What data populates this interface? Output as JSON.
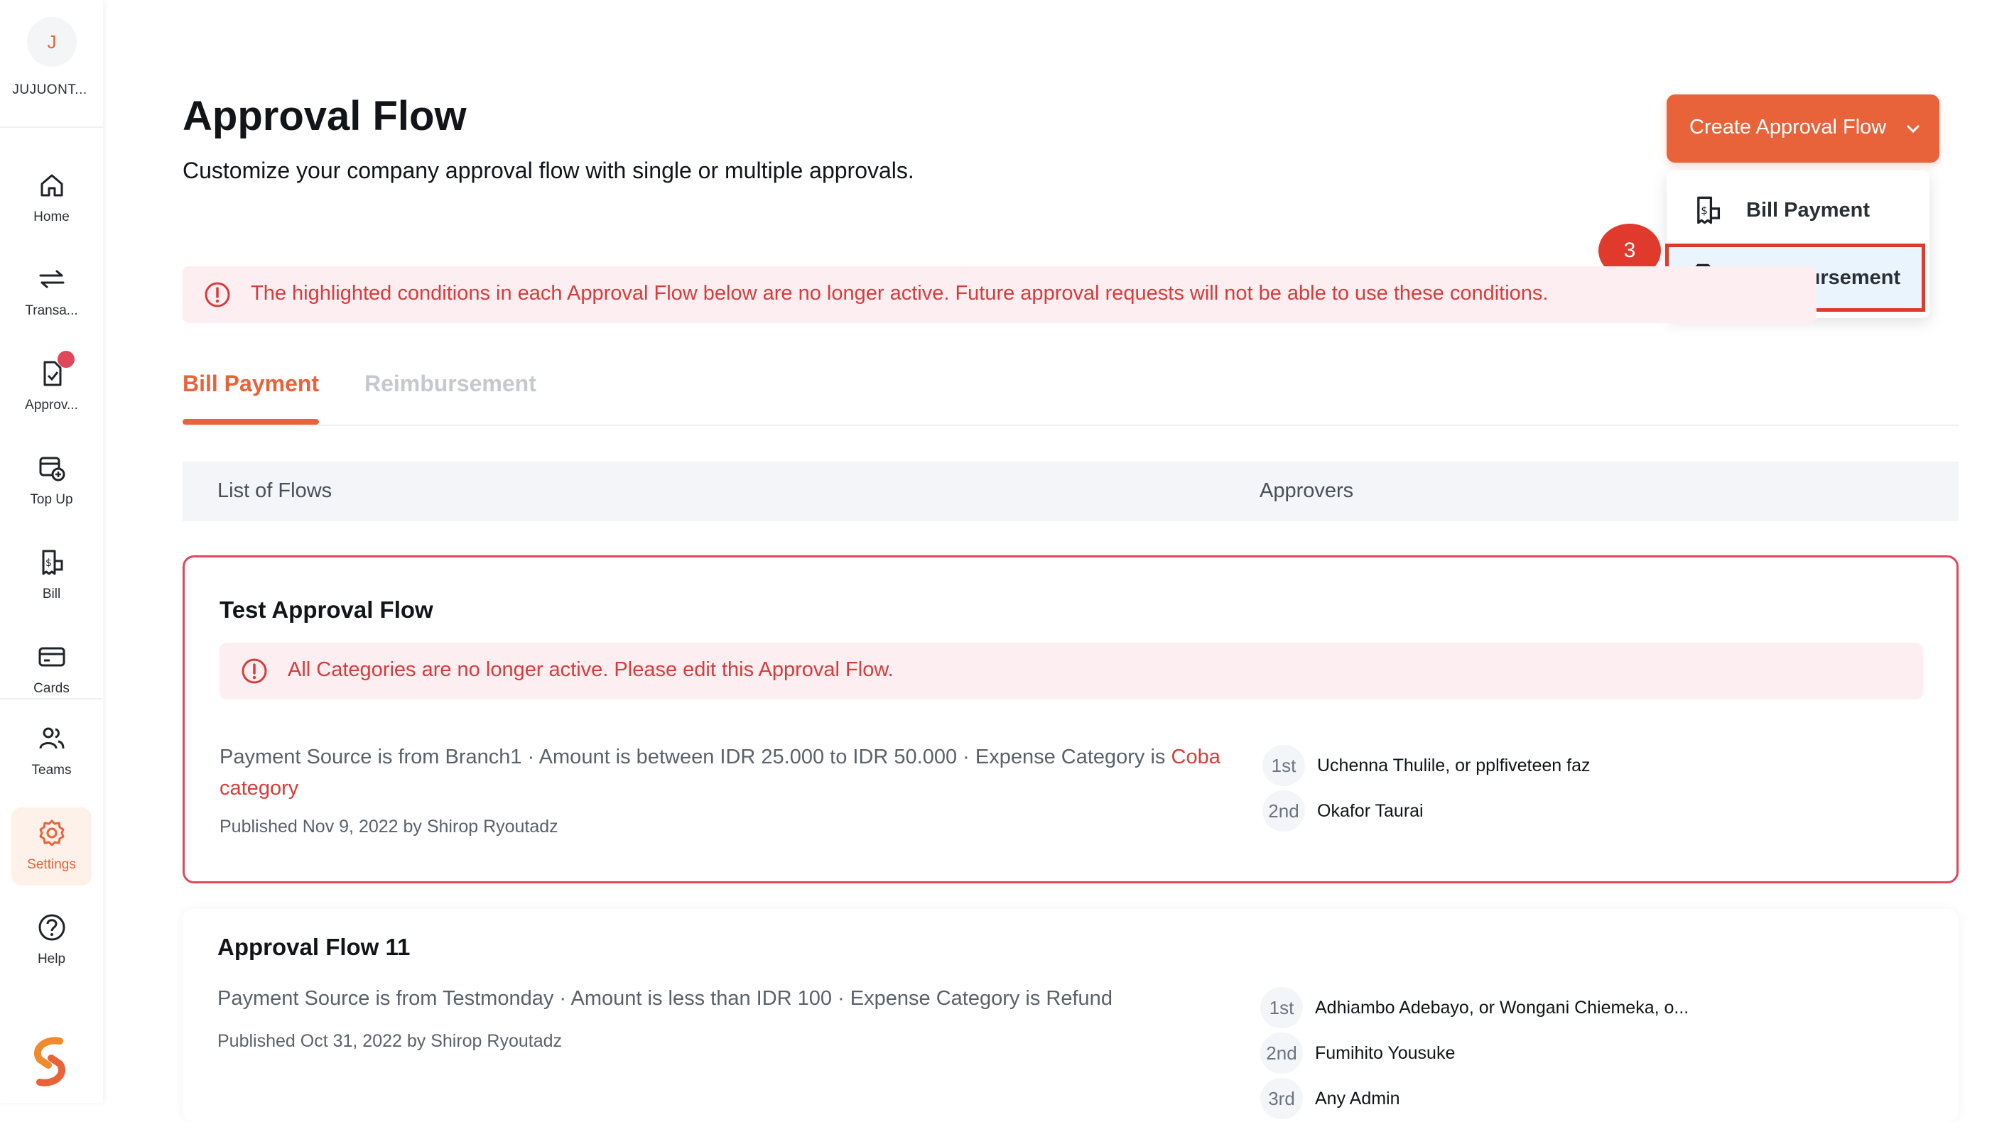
{
  "sidebar": {
    "org_initial": "J",
    "org_name": "JUJUONT...",
    "items": [
      {
        "label": "Home",
        "icon": "home-icon"
      },
      {
        "label": "Transa...",
        "icon": "transfer-arrows-icon"
      },
      {
        "label": "Approv...",
        "icon": "approval-document-icon",
        "badge": true
      },
      {
        "label": "Top Up",
        "icon": "top-up-icon"
      },
      {
        "label": "Bill",
        "icon": "bill-icon"
      },
      {
        "label": "Cards",
        "icon": "card-icon"
      },
      {
        "label": "Teams",
        "icon": "teams-icon"
      },
      {
        "label": "Settings",
        "icon": "gear-icon",
        "active": true
      },
      {
        "label": "Help",
        "icon": "help-icon"
      }
    ]
  },
  "header": {
    "title": "Approval Flow",
    "subtitle": "Customize your company approval flow with single or multiple approvals.",
    "create_button": "Create Approval Flow"
  },
  "dropdown": {
    "items": [
      {
        "label": "Bill Payment",
        "icon": "bill-icon"
      },
      {
        "label": "Reimbursement",
        "icon": "reimbursement-icon",
        "highlighted": true
      }
    ],
    "step_badge": "3"
  },
  "warning_banner": "The highlighted conditions in each Approval Flow below are no longer active. Future approval requests will not be able to use these conditions.",
  "tabs": [
    {
      "label": "Bill Payment",
      "active": true
    },
    {
      "label": "Reimbursement",
      "active": false
    }
  ],
  "table_header": {
    "col_flows": "List of Flows",
    "col_approvers": "Approvers"
  },
  "flows": [
    {
      "title": "Test Approval Flow",
      "alert": "All Categories are no longer active. Please edit this Approval Flow.",
      "condition_prefix": "Payment Source is from Branch1 · Amount is between IDR 25.000 to IDR 50.000 · Expense Category is ",
      "condition_highlight": "Coba category",
      "published": "Published Nov 9, 2022 by Shirop Ryoutadz",
      "approvers": [
        {
          "order": "1st",
          "name": "Uchenna Thulile, or pplfiveteen faz"
        },
        {
          "order": "2nd",
          "name": "Okafor Taurai"
        }
      ]
    },
    {
      "title": "Approval Flow 11",
      "condition": "Payment Source is from Testmonday · Amount is less than IDR 100 · Expense Category is Refund",
      "published": "Published Oct 31, 2022 by Shirop Ryoutadz",
      "approvers": [
        {
          "order": "1st",
          "name": "Adhiambo Adebayo, or Wongani Chiemeka, o..."
        },
        {
          "order": "2nd",
          "name": "Fumihito Yousuke"
        },
        {
          "order": "3rd",
          "name": "Any Admin"
        }
      ]
    }
  ],
  "colors": {
    "accent": "#e8623a",
    "danger": "#d93a3a",
    "danger_bg": "#fdeff1",
    "highlight_border": "#e03a2c",
    "selected_bg": "#eaf4fd"
  }
}
